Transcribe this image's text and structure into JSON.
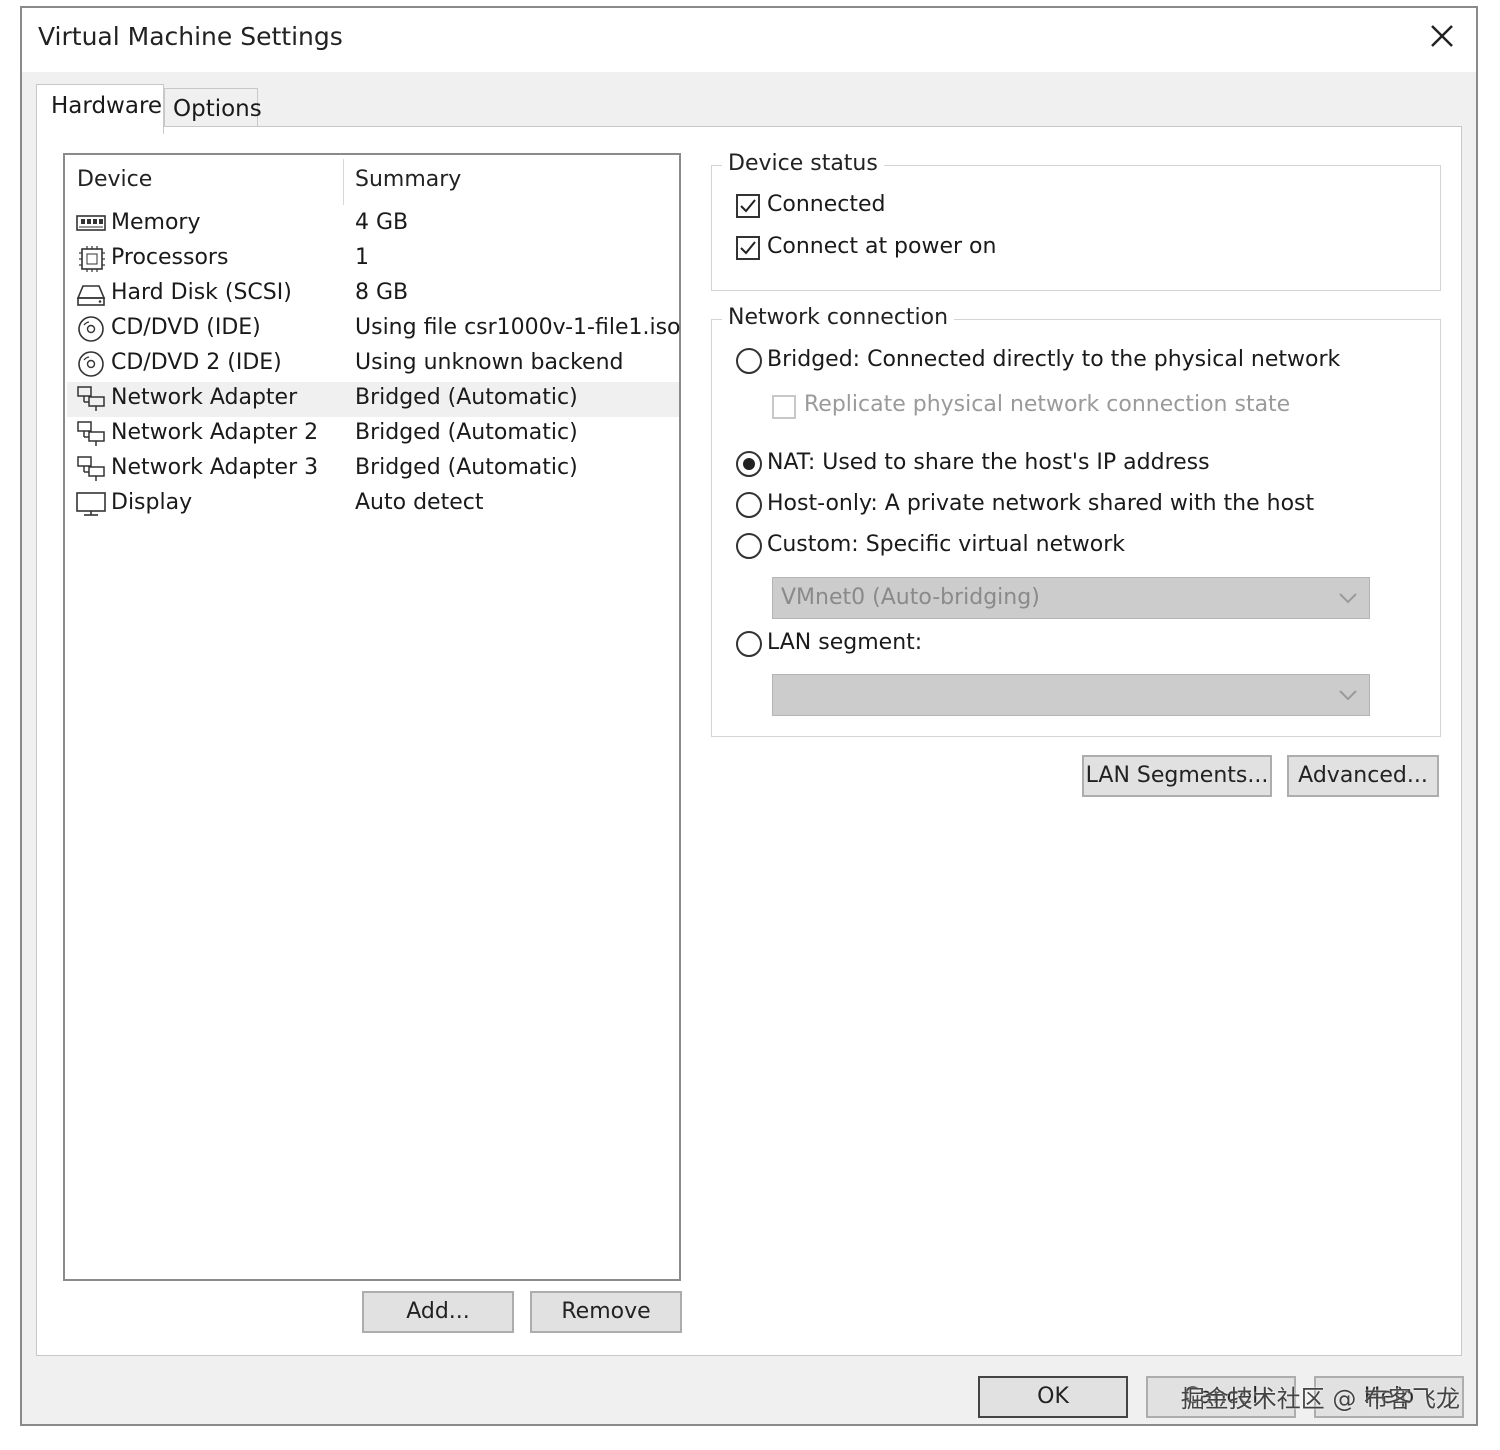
{
  "window": {
    "title": "Virtual Machine Settings"
  },
  "tabs": [
    {
      "label": "Hardware",
      "active": true
    },
    {
      "label": "Options",
      "active": false
    }
  ],
  "device_list": {
    "columns": {
      "device": "Device",
      "summary": "Summary"
    },
    "rows": [
      {
        "icon": "memory-icon",
        "device": "Memory",
        "summary": "4 GB"
      },
      {
        "icon": "processor-icon",
        "device": "Processors",
        "summary": "1"
      },
      {
        "icon": "hard-disk-icon",
        "device": "Hard Disk (SCSI)",
        "summary": "8 GB"
      },
      {
        "icon": "cd-dvd-icon",
        "device": "CD/DVD (IDE)",
        "summary": "Using file csr1000v-1-file1.iso"
      },
      {
        "icon": "cd-dvd-icon",
        "device": "CD/DVD 2 (IDE)",
        "summary": "Using unknown backend"
      },
      {
        "icon": "network-adapter-icon",
        "device": "Network Adapter",
        "summary": "Bridged (Automatic)",
        "selected": true
      },
      {
        "icon": "network-adapter-icon",
        "device": "Network Adapter 2",
        "summary": "Bridged (Automatic)"
      },
      {
        "icon": "network-adapter-icon",
        "device": "Network Adapter 3",
        "summary": "Bridged (Automatic)"
      },
      {
        "icon": "display-icon",
        "device": "Display",
        "summary": "Auto detect"
      }
    ],
    "buttons": {
      "add": "Add...",
      "remove": "Remove"
    }
  },
  "device_status": {
    "title": "Device status",
    "connected": {
      "label": "Connected",
      "checked": true
    },
    "connect_at_power_on": {
      "label": "Connect at power on",
      "checked": true
    }
  },
  "network_connection": {
    "title": "Network connection",
    "options": {
      "bridged": {
        "label": "Bridged: Connected directly to the physical network",
        "selected": false
      },
      "replicate": {
        "label": "Replicate physical network connection state",
        "checked": false,
        "disabled": true
      },
      "nat": {
        "label": "NAT: Used to share the host's IP address",
        "selected": true
      },
      "host_only": {
        "label": "Host-only: A private network shared with the host",
        "selected": false
      },
      "custom": {
        "label": "Custom: Specific virtual network",
        "selected": false
      },
      "lan_segment": {
        "label": "LAN segment:",
        "selected": false
      }
    },
    "custom_select": {
      "value": "VMnet0 (Auto-bridging)",
      "disabled": true
    },
    "lan_select": {
      "value": "",
      "disabled": true
    }
  },
  "network_buttons": {
    "lan_segments": "LAN Segments...",
    "advanced": "Advanced..."
  },
  "footer_buttons": {
    "ok": "OK",
    "cancel": "Cancel",
    "help": "Help"
  },
  "watermark": "掘金技术社区 @ 布客飞龙"
}
